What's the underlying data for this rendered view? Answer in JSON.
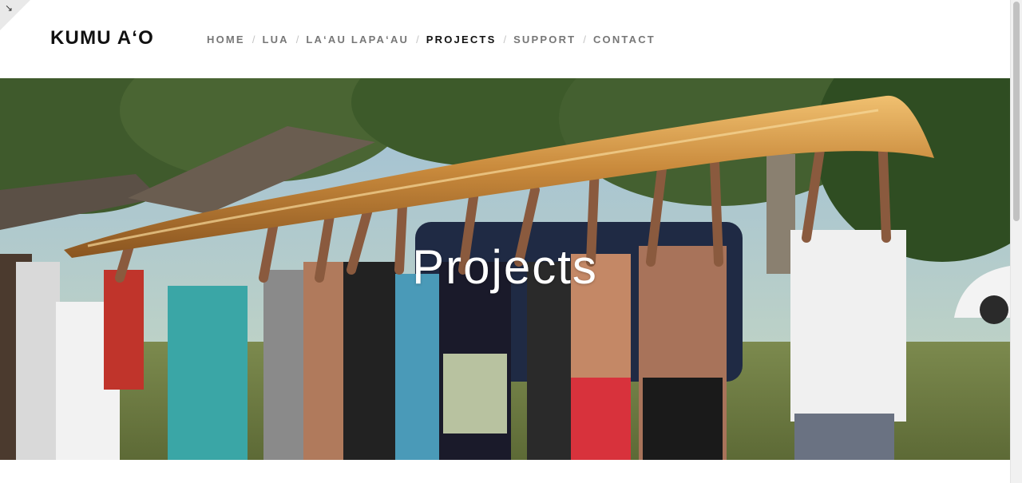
{
  "site": {
    "logo": "KUMU A‘O"
  },
  "nav": {
    "separator": "/",
    "items": [
      {
        "label": "HOME"
      },
      {
        "label": "LUA"
      },
      {
        "label": "LA‘AU LAPA‘AU"
      },
      {
        "label": "PROJECTS",
        "active": true
      },
      {
        "label": "SUPPORT"
      },
      {
        "label": "CONTACT"
      }
    ]
  },
  "hero": {
    "title": "Projects",
    "image": "group of people lifting a wooden outrigger canoe overhead"
  },
  "corner": {
    "icon": "↘"
  },
  "colors": {
    "nav_text": "#777777",
    "nav_active": "#111111",
    "title": "#ffffff"
  }
}
